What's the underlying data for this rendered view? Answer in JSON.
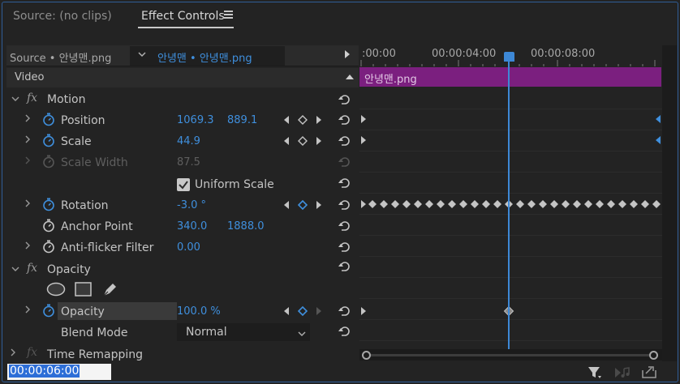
{
  "tabs": {
    "source": "Source: (no clips)",
    "effect_controls": "Effect Controls"
  },
  "header": {
    "source_clip": "Source • 안녕맨.png",
    "sequence": "안녕맨 • 안녕맨.png"
  },
  "ruler": {
    "t0": ":00:00",
    "t4": "00:00:04:00",
    "t8": "00:00:08:00"
  },
  "clip": {
    "name": "안녕맨.png",
    "color": "#7b1f7f"
  },
  "video": {
    "label": "Video"
  },
  "motion": {
    "label": "Motion",
    "position": {
      "label": "Position",
      "x": "1069.3",
      "y": "889.1"
    },
    "scale": {
      "label": "Scale",
      "value": "44.9"
    },
    "scale_width": {
      "label": "Scale Width",
      "value": "87.5"
    },
    "uniform_scale": {
      "label": "Uniform Scale",
      "checked": true
    },
    "rotation": {
      "label": "Rotation",
      "value": "-3.0 °"
    },
    "anchor_point": {
      "label": "Anchor Point",
      "x": "340.0",
      "y": "1888.0"
    },
    "anti_flicker": {
      "label": "Anti-flicker Filter",
      "value": "0.00"
    }
  },
  "opacity": {
    "section_label": "Opacity",
    "mask_tools": [
      "ellipse-mask-icon",
      "rectangle-mask-icon",
      "pen-mask-icon"
    ],
    "opacity": {
      "label": "Opacity",
      "value": "100.0 %"
    },
    "blend_mode": {
      "label": "Blend Mode",
      "value": "Normal"
    }
  },
  "time_remapping": {
    "label": "Time Remapping"
  },
  "timecode": "00:00:06:00",
  "colors": {
    "accent": "#3d88d6",
    "value_blue": "#3f8fdd",
    "clip_purple": "#7b1f7f"
  }
}
